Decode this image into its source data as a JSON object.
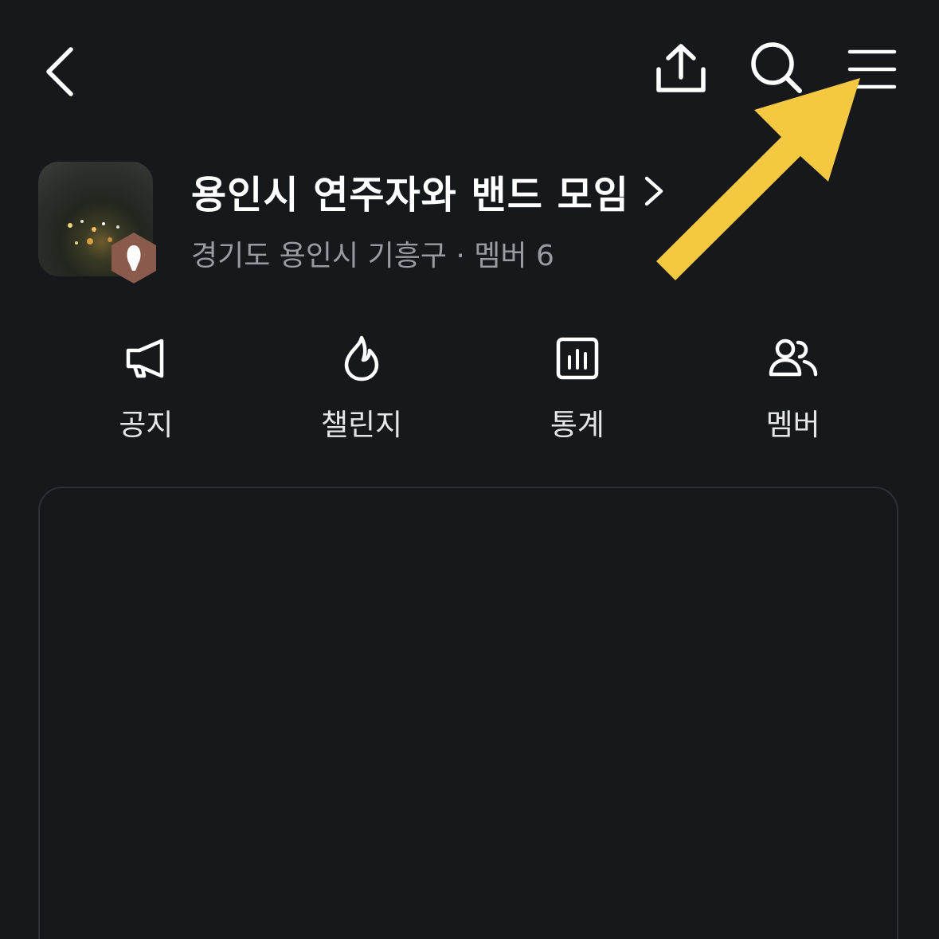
{
  "header": {
    "back_icon": "chevron-left-icon",
    "share_icon": "share-upload-icon",
    "search_icon": "search-icon",
    "menu_icon": "hamburger-menu-icon"
  },
  "band": {
    "title": "용인시 연주자와 밴드 모임",
    "meta": "경기도 용인시 기흥구 · 멤버 6",
    "badge_color": "#8a5a4c"
  },
  "quick_menu": {
    "items": [
      {
        "label": "공지",
        "icon": "megaphone-icon"
      },
      {
        "label": "챌린지",
        "icon": "flame-icon"
      },
      {
        "label": "통계",
        "icon": "bar-chart-icon"
      },
      {
        "label": "멤버",
        "icon": "members-icon"
      }
    ]
  },
  "annotation": {
    "arrow_color": "#f5c842"
  }
}
